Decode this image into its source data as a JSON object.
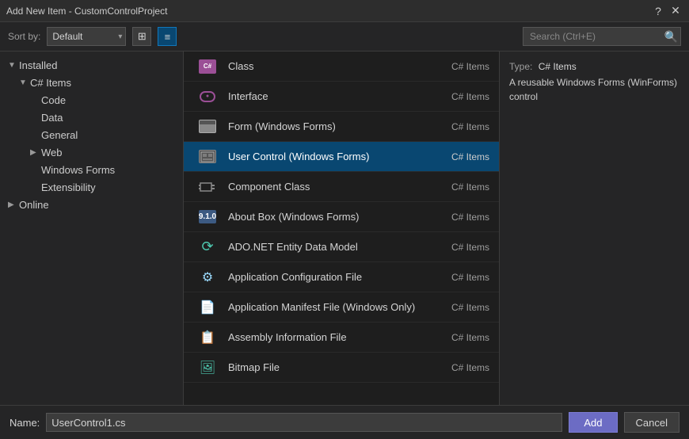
{
  "titleBar": {
    "title": "Add New Item - CustomControlProject",
    "helpBtn": "?",
    "closeBtn": "✕"
  },
  "toolbar": {
    "sortLabel": "Sort by:",
    "sortDefault": "Default",
    "viewGrid": "⊞",
    "viewList": "≡",
    "searchPlaceholder": "Search (Ctrl+E)"
  },
  "sidebar": {
    "sections": [
      {
        "id": "installed",
        "label": "Installed",
        "level": 0,
        "arrow": "open"
      },
      {
        "id": "csharp-items",
        "label": "C# Items",
        "level": 1,
        "arrow": "open"
      },
      {
        "id": "code",
        "label": "Code",
        "level": 2,
        "arrow": "leaf"
      },
      {
        "id": "data",
        "label": "Data",
        "level": 2,
        "arrow": "leaf"
      },
      {
        "id": "general",
        "label": "General",
        "level": 2,
        "arrow": "leaf"
      },
      {
        "id": "web",
        "label": "Web",
        "level": 2,
        "arrow": "closed"
      },
      {
        "id": "windows-forms",
        "label": "Windows Forms",
        "level": 2,
        "arrow": "leaf"
      },
      {
        "id": "extensibility",
        "label": "Extensibility",
        "level": 2,
        "arrow": "leaf"
      },
      {
        "id": "online",
        "label": "Online",
        "level": 0,
        "arrow": "closed"
      }
    ]
  },
  "items": [
    {
      "id": "class",
      "name": "Class",
      "tag": "C# Items",
      "iconType": "cs"
    },
    {
      "id": "interface",
      "name": "Interface",
      "tag": "C# Items",
      "iconType": "interface"
    },
    {
      "id": "form-wf",
      "name": "Form (Windows Forms)",
      "tag": "C# Items",
      "iconType": "form"
    },
    {
      "id": "user-control-wf",
      "name": "User Control (Windows Forms)",
      "tag": "C# Items",
      "iconType": "usercontrol",
      "selected": true
    },
    {
      "id": "component-class",
      "name": "Component Class",
      "tag": "C# Items",
      "iconType": "component"
    },
    {
      "id": "about-box",
      "name": "About Box (Windows Forms)",
      "tag": "C# Items",
      "iconType": "about"
    },
    {
      "id": "ado-entity",
      "name": "ADO.NET Entity Data Model",
      "tag": "C# Items",
      "iconType": "ado"
    },
    {
      "id": "app-config",
      "name": "Application Configuration File",
      "tag": "C# Items",
      "iconType": "config"
    },
    {
      "id": "app-manifest",
      "name": "Application Manifest File (Windows Only)",
      "tag": "C# Items",
      "iconType": "manifest"
    },
    {
      "id": "assembly-info",
      "name": "Assembly Information File",
      "tag": "C# Items",
      "iconType": "assembly"
    },
    {
      "id": "bitmap",
      "name": "Bitmap File",
      "tag": "C# Items",
      "iconType": "bitmap"
    }
  ],
  "infoPanel": {
    "typePrefix": "Type:",
    "typeValue": "C# Items",
    "description": "A reusable Windows Forms (WinForms) control"
  },
  "bottomBar": {
    "nameLabel": "Name:",
    "nameValue": "UserControl1.cs",
    "addBtn": "Add",
    "cancelBtn": "Cancel"
  }
}
